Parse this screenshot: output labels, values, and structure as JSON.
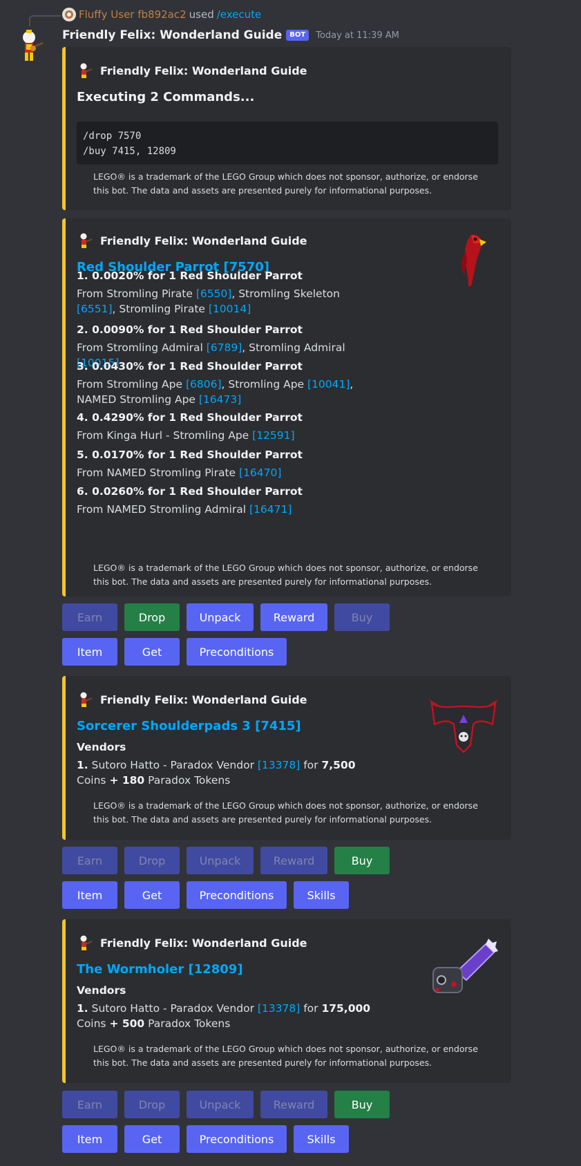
{
  "reply": {
    "user": "Fluffy User fb892ac2",
    "used": "used",
    "command": "/execute"
  },
  "message": {
    "bot_name": "Friendly Felix: Wonderland Guide",
    "bot_tag": "BOT",
    "timestamp": "Today at 11:39 AM"
  },
  "footer_text": "LEGO® is a trademark of the LEGO Group which does not sponsor, authorize, or endorse this bot. The data and assets are presented purely for informational purposes.",
  "embed1": {
    "author": "Friendly Felix: Wonderland Guide",
    "title": "Executing 2 Commands...",
    "code_lines": [
      "/drop 7570",
      "/buy 7415, 12809"
    ]
  },
  "embed2": {
    "author": "Friendly Felix: Wonderland Guide",
    "title": "Red Shoulder Parrot [7570]",
    "fields": [
      {
        "name": "1. 0.0020% for 1 Red Shoulder Parrot",
        "value": [
          {
            "t": "From Stromling Pirate "
          },
          {
            "t": "[6550]",
            "link": true
          },
          {
            "t": ", Stromling Skeleton "
          },
          {
            "t": "[6551]",
            "link": true
          },
          {
            "t": ", Stromling Pirate "
          },
          {
            "t": "[10014]",
            "link": true
          }
        ]
      },
      {
        "name": "2. 0.0090% for 1 Red Shoulder Parrot",
        "value": [
          {
            "t": "From Stromling Admiral "
          },
          {
            "t": "[6789]",
            "link": true
          },
          {
            "t": ", Stromling Admiral "
          },
          {
            "t": "[10015]",
            "link": true
          }
        ]
      },
      {
        "name": "3. 0.0430% for 1 Red Shoulder Parrot",
        "value": [
          {
            "t": "From Stromling Ape "
          },
          {
            "t": "[6806]",
            "link": true
          },
          {
            "t": ", Stromling Ape "
          },
          {
            "t": "[10041]",
            "link": true
          },
          {
            "t": ", NAMED Stromling Ape "
          },
          {
            "t": "[16473]",
            "link": true
          }
        ]
      },
      {
        "name": "4. 0.4290% for 1 Red Shoulder Parrot",
        "value": [
          {
            "t": "From Kinga Hurl - Stromling Ape "
          },
          {
            "t": "[12591]",
            "link": true
          }
        ]
      },
      {
        "name": "5. 0.0170% for 1 Red Shoulder Parrot",
        "value": [
          {
            "t": "From NAMED Stromling Pirate "
          },
          {
            "t": "[16470]",
            "link": true
          }
        ]
      },
      {
        "name": "6. 0.0260% for 1 Red Shoulder Parrot",
        "value": [
          {
            "t": "From NAMED Stromling Admiral "
          },
          {
            "t": "[16471]",
            "link": true
          }
        ]
      }
    ]
  },
  "buttons1": {
    "row1": [
      {
        "label": "Earn",
        "style": "disabled"
      },
      {
        "label": "Drop",
        "style": "success"
      },
      {
        "label": "Unpack",
        "style": "primary"
      },
      {
        "label": "Reward",
        "style": "primary"
      },
      {
        "label": "Buy",
        "style": "disabled"
      }
    ],
    "row2": [
      {
        "label": "Item",
        "style": "primary"
      },
      {
        "label": "Get",
        "style": "primary"
      },
      {
        "label": "Preconditions",
        "style": "primary"
      }
    ]
  },
  "embed3": {
    "author": "Friendly Felix: Wonderland Guide",
    "title": "Sorcerer Shoulderpads 3 [7415]",
    "field_name": "Vendors",
    "value": [
      {
        "t": "1.",
        "bold": true
      },
      {
        "t": " Sutoro Hatto - Paradox Vendor "
      },
      {
        "t": "[13378]",
        "link": true
      },
      {
        "t": " for "
      },
      {
        "t": "7,500",
        "bold": true
      },
      {
        "t": " Coins "
      },
      {
        "t": "+ 180",
        "bold": true
      },
      {
        "t": " Paradox Tokens"
      }
    ]
  },
  "buttons2": {
    "row1": [
      {
        "label": "Earn",
        "style": "disabled"
      },
      {
        "label": "Drop",
        "style": "disabled"
      },
      {
        "label": "Unpack",
        "style": "disabled"
      },
      {
        "label": "Reward",
        "style": "disabled"
      },
      {
        "label": "Buy",
        "style": "success"
      }
    ],
    "row2": [
      {
        "label": "Item",
        "style": "primary"
      },
      {
        "label": "Get",
        "style": "primary"
      },
      {
        "label": "Preconditions",
        "style": "primary"
      },
      {
        "label": "Skills",
        "style": "primary"
      }
    ]
  },
  "embed4": {
    "author": "Friendly Felix: Wonderland Guide",
    "title": "The Wormholer [12809]",
    "field_name": "Vendors",
    "value": [
      {
        "t": "1.",
        "bold": true
      },
      {
        "t": " Sutoro Hatto - Paradox Vendor "
      },
      {
        "t": "[13378]",
        "link": true
      },
      {
        "t": " for "
      },
      {
        "t": "175,000",
        "bold": true
      },
      {
        "t": " Coins "
      },
      {
        "t": "+ 500",
        "bold": true
      },
      {
        "t": " Paradox Tokens"
      }
    ]
  },
  "buttons3": {
    "row1": [
      {
        "label": "Earn",
        "style": "disabled"
      },
      {
        "label": "Drop",
        "style": "disabled"
      },
      {
        "label": "Unpack",
        "style": "disabled"
      },
      {
        "label": "Reward",
        "style": "disabled"
      },
      {
        "label": "Buy",
        "style": "success"
      }
    ],
    "row2": [
      {
        "label": "Item",
        "style": "primary"
      },
      {
        "label": "Get",
        "style": "primary"
      },
      {
        "label": "Preconditions",
        "style": "primary"
      },
      {
        "label": "Skills",
        "style": "primary"
      }
    ]
  },
  "colors": {
    "embed_accent": "#f0c62c",
    "link": "#00a8fc",
    "primary": "#5865f2",
    "success": "#248046",
    "background": "#313338",
    "embed_bg": "#2b2d31"
  },
  "icons": {
    "avatar": "felix-avatar-icon",
    "parrot": "parrot-thumbnail",
    "shoulderpads": "shoulderpads-thumbnail",
    "wormholer": "wormholer-thumbnail"
  }
}
